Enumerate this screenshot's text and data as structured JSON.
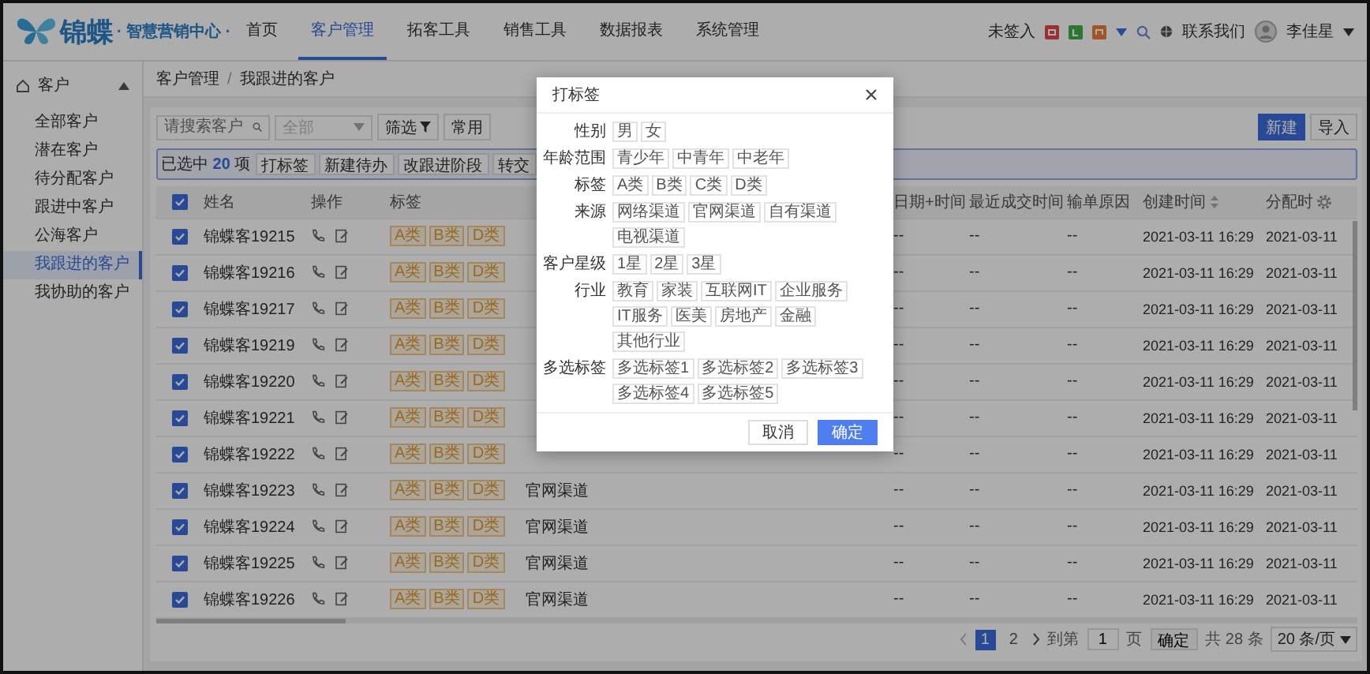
{
  "header": {
    "logo_text": "锦蝶",
    "subtitle": "· 智慧营销中心 ·",
    "nav": [
      {
        "label": "首页",
        "selected": false
      },
      {
        "label": "客户管理",
        "selected": true
      },
      {
        "label": "拓客工具",
        "selected": false
      },
      {
        "label": "销售工具",
        "selected": false
      },
      {
        "label": "数据报表",
        "selected": false
      },
      {
        "label": "系统管理",
        "selected": false
      }
    ],
    "status": "未签入",
    "contact": "联系我们",
    "user": "李佳星"
  },
  "sidebar": {
    "title": "客户",
    "expanded": true,
    "items": [
      {
        "label": "全部客户",
        "selected": false
      },
      {
        "label": "潜在客户",
        "selected": false
      },
      {
        "label": "待分配客户",
        "selected": false
      },
      {
        "label": "跟进中客户",
        "selected": false
      },
      {
        "label": "公海客户",
        "selected": false
      },
      {
        "label": "我跟进的客户",
        "selected": true
      },
      {
        "label": "我协助的客户",
        "selected": false
      }
    ]
  },
  "breadcrumb": [
    "客户管理",
    "我跟进的客户"
  ],
  "breadcrumb_separator": "/",
  "toolbar": {
    "search_placeholder": "请搜索客户",
    "select_placeholder": "全部",
    "filter": "筛选",
    "common": "常用",
    "new": "新建",
    "import": "导入"
  },
  "selection": {
    "prefix": "已选中",
    "count": "20",
    "suffix": "项",
    "actions": [
      "打标签",
      "新建待办",
      "改跟进阶段",
      "转交"
    ]
  },
  "table": {
    "all_checked": true,
    "columns": [
      "姓名",
      "操作",
      "标签",
      "日期+时间",
      "最近成交时间",
      "输单原因",
      "创建时间",
      "分配时"
    ],
    "rows": [
      {
        "name": "锦蝶客19215",
        "checked": true,
        "tags": [
          "A类",
          "B类",
          "D类"
        ],
        "date_time": "--",
        "last_deal": "--",
        "loss_reason": "--",
        "created": "2021-03-11 16:29",
        "assigned": "2021-03-11"
      },
      {
        "name": "锦蝶客19216",
        "checked": true,
        "tags": [
          "A类",
          "B类",
          "D类"
        ],
        "date_time": "--",
        "last_deal": "--",
        "loss_reason": "--",
        "created": "2021-03-11 16:29",
        "assigned": "2021-03-11"
      },
      {
        "name": "锦蝶客19217",
        "checked": true,
        "tags": [
          "A类",
          "B类",
          "D类"
        ],
        "date_time": "--",
        "last_deal": "--",
        "loss_reason": "--",
        "created": "2021-03-11 16:29",
        "assigned": "2021-03-11"
      },
      {
        "name": "锦蝶客19219",
        "checked": true,
        "tags": [
          "A类",
          "B类",
          "D类"
        ],
        "date_time": "--",
        "last_deal": "--",
        "loss_reason": "--",
        "created": "2021-03-11 16:29",
        "assigned": "2021-03-11"
      },
      {
        "name": "锦蝶客19220",
        "checked": true,
        "tags": [
          "A类",
          "B类",
          "D类"
        ],
        "date_time": "--",
        "last_deal": "--",
        "loss_reason": "--",
        "created": "2021-03-11 16:29",
        "assigned": "2021-03-11"
      },
      {
        "name": "锦蝶客19221",
        "checked": true,
        "tags": [
          "A类",
          "B类",
          "D类"
        ],
        "date_time": "--",
        "last_deal": "--",
        "loss_reason": "--",
        "created": "2021-03-11 16:29",
        "assigned": "2021-03-11"
      },
      {
        "name": "锦蝶客19222",
        "checked": true,
        "tags": [
          "A类",
          "B类",
          "D类"
        ],
        "date_time": "--",
        "last_deal": "--",
        "loss_reason": "--",
        "created": "2021-03-11 16:29",
        "assigned": "2021-03-11"
      },
      {
        "name": "锦蝶客19223",
        "checked": true,
        "tags": [
          "A类",
          "B类",
          "D类"
        ],
        "source": "官网渠道",
        "date_time": "--",
        "last_deal": "--",
        "loss_reason": "--",
        "created": "2021-03-11 16:29",
        "assigned": "2021-03-11"
      },
      {
        "name": "锦蝶客19224",
        "checked": true,
        "tags": [
          "A类",
          "B类",
          "D类"
        ],
        "source": "官网渠道",
        "date_time": "--",
        "last_deal": "--",
        "loss_reason": "--",
        "created": "2021-03-11 16:29",
        "assigned": "2021-03-11"
      },
      {
        "name": "锦蝶客19225",
        "checked": true,
        "tags": [
          "A类",
          "B类",
          "D类"
        ],
        "source": "官网渠道",
        "date_time": "--",
        "last_deal": "--",
        "loss_reason": "--",
        "created": "2021-03-11 16:29",
        "assigned": "2021-03-11"
      },
      {
        "name": "锦蝶客19226",
        "checked": true,
        "tags": [
          "A类",
          "B类",
          "D类"
        ],
        "source": "官网渠道",
        "date_time": "--",
        "last_deal": "--",
        "loss_reason": "--",
        "created": "2021-03-11 16:29",
        "assigned": "2021-03-11"
      }
    ]
  },
  "pagination": {
    "pages": [
      {
        "label": "1",
        "selected": true
      },
      {
        "label": "2",
        "selected": false
      }
    ],
    "goto": "到第",
    "page_value": "1",
    "page_unit": "页",
    "confirm": "确定",
    "total": "共 28 条",
    "page_size": "20 条/页"
  },
  "dialog": {
    "title": "打标签",
    "groups": [
      {
        "label": "性别",
        "options": [
          {
            "label": "男",
            "selected": false
          },
          {
            "label": "女",
            "selected": false
          }
        ]
      },
      {
        "label": "年龄范围",
        "options": [
          {
            "label": "青少年",
            "selected": false
          },
          {
            "label": "中青年",
            "selected": false
          },
          {
            "label": "中老年",
            "selected": false
          }
        ]
      },
      {
        "label": "标签",
        "options": [
          {
            "label": "A类",
            "selected": false
          },
          {
            "label": "B类",
            "selected": false
          },
          {
            "label": "C类",
            "selected": false
          },
          {
            "label": "D类",
            "selected": false
          }
        ]
      },
      {
        "label": "来源",
        "options": [
          {
            "label": "网络渠道",
            "selected": false
          },
          {
            "label": "官网渠道",
            "selected": false
          },
          {
            "label": "自有渠道",
            "selected": false
          },
          {
            "label": "电视渠道",
            "selected": false
          }
        ]
      },
      {
        "label": "客户星级",
        "options": [
          {
            "label": "1星",
            "selected": false
          },
          {
            "label": "2星",
            "selected": false
          },
          {
            "label": "3星",
            "selected": false
          }
        ]
      },
      {
        "label": "行业",
        "options": [
          {
            "label": "教育",
            "selected": false
          },
          {
            "label": "家装",
            "selected": false
          },
          {
            "label": "互联网IT",
            "selected": false
          },
          {
            "label": "企业服务",
            "selected": false
          },
          {
            "label": "IT服务",
            "selected": false
          },
          {
            "label": "医美",
            "selected": false
          },
          {
            "label": "房地产",
            "selected": false
          },
          {
            "label": "金融",
            "selected": false
          },
          {
            "label": "其他行业",
            "selected": false
          }
        ]
      },
      {
        "label": "多选标签",
        "options": [
          {
            "label": "多选标签1",
            "selected": false
          },
          {
            "label": "多选标签2",
            "selected": false
          },
          {
            "label": "多选标签3",
            "selected": false
          },
          {
            "label": "多选标签4",
            "selected": false
          },
          {
            "label": "多选标签5",
            "selected": false
          }
        ]
      }
    ],
    "cancel": "取消",
    "ok": "确定"
  }
}
